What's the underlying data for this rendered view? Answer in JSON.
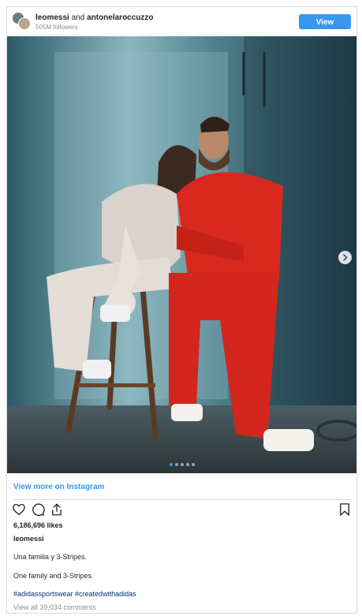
{
  "header": {
    "username": "leomessi",
    "joiner": "and",
    "collaborator": "antonelaroccuzzo",
    "followers": "505M followers",
    "view_profile_label": "View profile"
  },
  "photo": {
    "description_icon": "photo-of-couple-sitting-on-stools",
    "carousel_count": 5,
    "active_index": 0
  },
  "view_more_label": "View more on Instagram",
  "actions": {
    "like_icon": "heart-icon",
    "comment_icon": "comment-icon",
    "share_icon": "share-icon",
    "save_icon": "bookmark-icon"
  },
  "likes": "6,186,696 likes",
  "owner": "leomessi",
  "caption": {
    "line1": "Una familia y 3-Stripes.",
    "line2": "One family and 3-Stripes.",
    "hashtags": "#adidassportswear #createdwithadidas"
  },
  "comments_link": "View all 39,034 comments",
  "colors": {
    "accent": "#3897f0",
    "hashtag": "#003569",
    "muted": "#8e8e8e",
    "border": "#dbdbdb"
  }
}
